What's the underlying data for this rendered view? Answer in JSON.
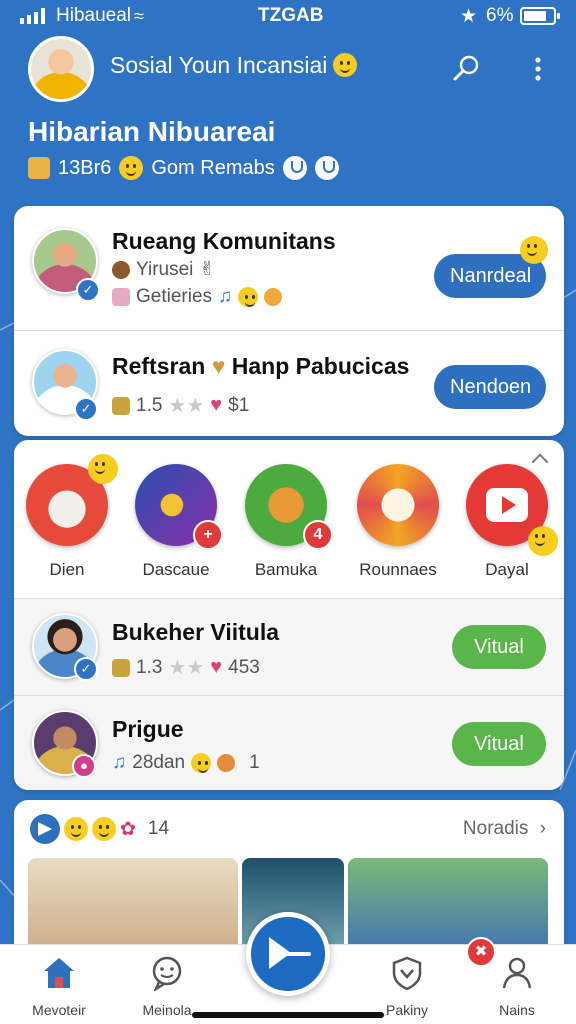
{
  "status_bar": {
    "carrier": "Hibaueal",
    "time": "TZGAB",
    "battery": "6%"
  },
  "header": {
    "title": "Sosial Youn Incansiai"
  },
  "page": {
    "title": "Hibarian Nibuareai",
    "stat": "13Br6",
    "subtitle": "Gom Remabs"
  },
  "community": [
    {
      "title": "Rueang Komunitans",
      "meta1": "Yirusei",
      "meta2": "Getieries",
      "action": "Nanrdeal"
    },
    {
      "title": "Reftsran",
      "title2": "Hanp Pabucicas",
      "rating": "1.5",
      "price": "$1",
      "action": "Nendoen"
    }
  ],
  "apps": [
    {
      "label": "Dien",
      "color": "#e64a3a",
      "badge": ""
    },
    {
      "label": "Dascaue",
      "color": "#6a3db8",
      "badge": "+"
    },
    {
      "label": "Bamuka",
      "color": "#4caa3e",
      "badge": "4"
    },
    {
      "label": "Rounnaes",
      "color": "#f2a623",
      "badge": ""
    },
    {
      "label": "Dayal",
      "color": "#e53935",
      "badge": ""
    }
  ],
  "people": [
    {
      "title": "Bukeher Viitula",
      "rating": "1.3",
      "count": "453",
      "action": "Vitual"
    },
    {
      "title": "Prigue",
      "meta": "28dan",
      "count": "1",
      "action": "Vitual"
    }
  ],
  "feed": {
    "count": "14",
    "see_more": "Noradis"
  },
  "nav": [
    {
      "label": "Mevoteir",
      "icon": "home-icon"
    },
    {
      "label": "Meinola",
      "icon": "chat-icon"
    },
    {
      "label": "Pakiny",
      "icon": "heart-shield-icon"
    },
    {
      "label": "Nains",
      "icon": "profile-icon"
    }
  ],
  "colors": {
    "brand": "#2f74c4",
    "primary_button": "#2f6fc0",
    "success_button": "#5ab54a",
    "badge": "#e03a3a"
  }
}
